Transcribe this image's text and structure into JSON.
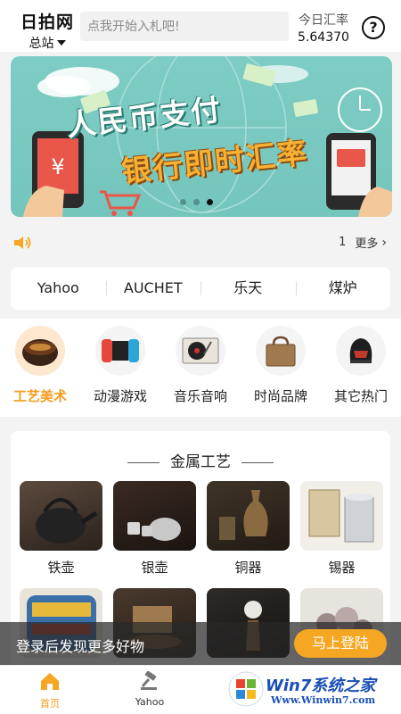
{
  "header": {
    "brand_title": "日拍网",
    "brand_sub": "总站",
    "search_placeholder": "点我开始入札吧!",
    "rate_label": "今日汇率",
    "rate_value": "5.64370",
    "help_glyph": "?"
  },
  "banner": {
    "line1": "人民币支付",
    "line2": "银行即时汇率",
    "slide_count": 3,
    "active_slide": 3,
    "colors": {
      "background": "#7ecdc4",
      "accent": "#f7b235"
    }
  },
  "notice": {
    "count": "1",
    "more_label": "更多"
  },
  "sites": [
    "Yahoo",
    "AUCHET",
    "乐天",
    "煤炉"
  ],
  "categories": [
    {
      "label": "工艺美术",
      "icon": "lacquer-bowl-icon",
      "active": true
    },
    {
      "label": "动漫游戏",
      "icon": "game-console-icon",
      "active": false
    },
    {
      "label": "音乐音响",
      "icon": "turntable-icon",
      "active": false
    },
    {
      "label": "时尚品牌",
      "icon": "handbag-icon",
      "active": false
    },
    {
      "label": "其它热门",
      "icon": "helmet-icon",
      "active": false
    }
  ],
  "panel": {
    "title": "金属工艺",
    "items": [
      {
        "label": "铁壶"
      },
      {
        "label": "银壶"
      },
      {
        "label": "铜器"
      },
      {
        "label": "锡器"
      },
      {
        "label": ""
      },
      {
        "label": ""
      },
      {
        "label": ""
      },
      {
        "label": ""
      }
    ]
  },
  "login_bar": {
    "text": "登录后发现更多好物",
    "button": "马上登陆"
  },
  "nav": [
    {
      "label": "首页",
      "icon": "home-icon",
      "active": true
    },
    {
      "label": "Yahoo",
      "icon": "gavel-icon",
      "active": false
    }
  ],
  "watermark": {
    "title": "Win7系统之家",
    "url": "Www.Winwin7.com"
  },
  "accent_color": "#f49b1c"
}
